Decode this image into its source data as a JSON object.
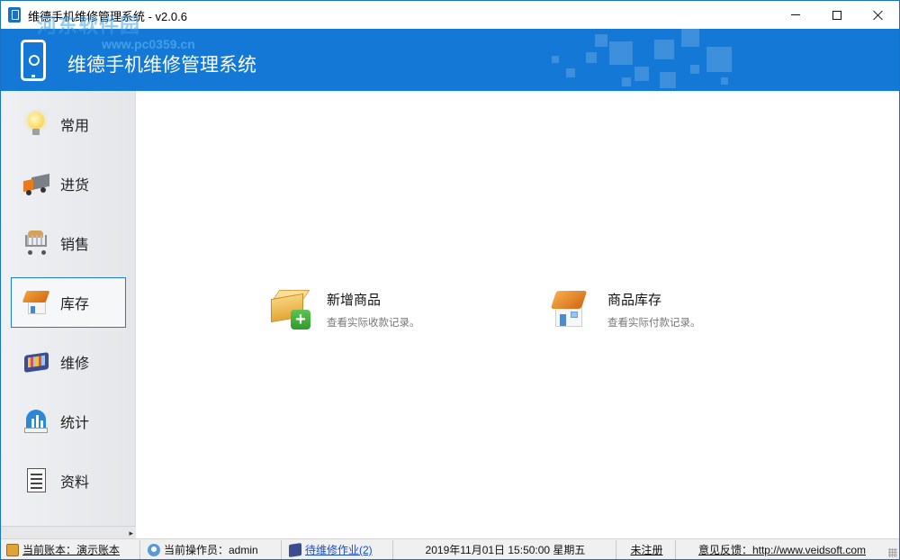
{
  "window": {
    "title": "维德手机维修管理系统 - v2.0.6",
    "watermark": "河东软件园",
    "watermark_url": "www.pc0359.cn"
  },
  "banner": {
    "title": "维德手机维修管理系统",
    "background": "#1478d6"
  },
  "sidebar": {
    "items": [
      {
        "label": "常用",
        "icon": "light-bulb-icon"
      },
      {
        "label": "进货",
        "icon": "truck-icon"
      },
      {
        "label": "销售",
        "icon": "shopping-cart-icon"
      },
      {
        "label": "库存",
        "icon": "warehouse-icon",
        "active": true
      },
      {
        "label": "维修",
        "icon": "toolkit-icon"
      },
      {
        "label": "统计",
        "icon": "statistics-icon"
      },
      {
        "label": "资料",
        "icon": "document-icon"
      }
    ]
  },
  "main": {
    "tiles": [
      {
        "title": "新增商品",
        "desc": "查看实际收款记录。",
        "icon": "add-goods-icon"
      },
      {
        "title": "商品库存",
        "desc": "查看实际付款记录。",
        "icon": "goods-stock-icon"
      }
    ]
  },
  "statusbar": {
    "account": "当前账本：演示账本",
    "operator": "当前操作员：admin",
    "pending": "待维修作业(2)",
    "datetime": "2019年11月01日 15:50:00 星期五",
    "register": "未注册",
    "feedback": "意见反馈：http://www.veidsoft.com"
  },
  "colors": {
    "accent": "#1478d6",
    "active_border": "#1e7bd0",
    "link": "#1a4fc7"
  }
}
